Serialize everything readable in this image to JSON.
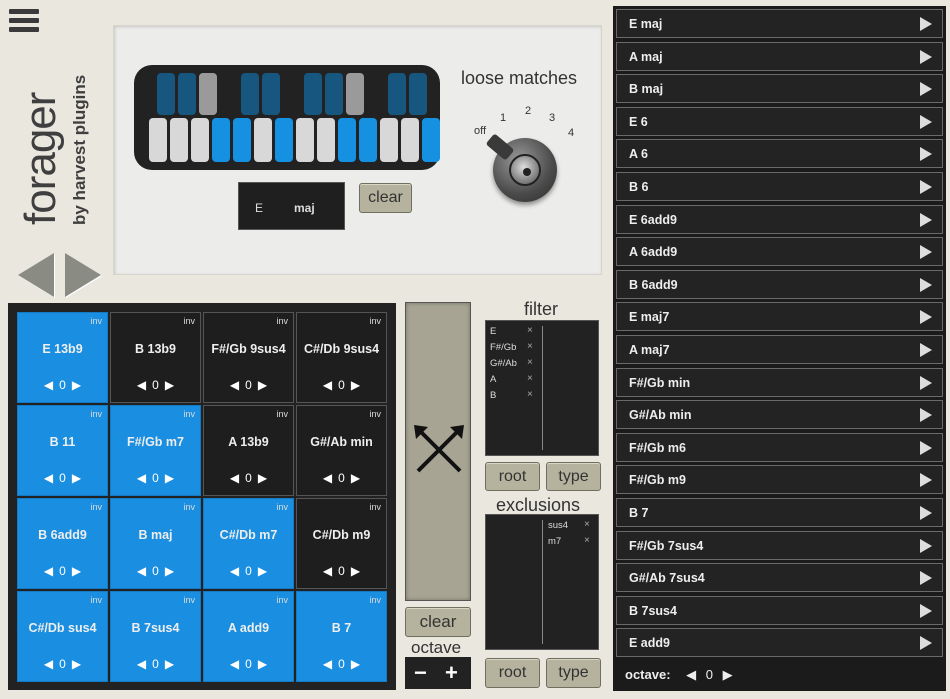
{
  "brand": {
    "name": "forager",
    "sub": "by harvest plugins"
  },
  "keyboard": {
    "white_keys_on": [
      3,
      4,
      6,
      9,
      10,
      13
    ],
    "black_keys": [
      {
        "state": "dark"
      },
      {
        "state": "dark"
      },
      {
        "state": "gray"
      },
      {
        "state": "dark"
      },
      {
        "state": "dark"
      },
      {
        "state": "dark"
      },
      {
        "state": "dark"
      },
      {
        "state": "gray"
      },
      {
        "state": "dark"
      },
      {
        "state": "dark"
      }
    ],
    "colors": {
      "active": "#1690e0",
      "inactive_white": "#d8d8d8",
      "black": "#16567f",
      "gray": "#9a9a9a"
    }
  },
  "chord_display": {
    "root": "E",
    "quality": "maj"
  },
  "top_clear_label": "clear",
  "loose_matches": {
    "label": "loose matches",
    "ticks": [
      "off",
      "1",
      "2",
      "3",
      "4"
    ],
    "value": "off"
  },
  "pads": [
    {
      "name": "E 13b9",
      "inv": "inv",
      "value": "0",
      "active": true
    },
    {
      "name": "B 13b9",
      "inv": "inv",
      "value": "0",
      "active": false
    },
    {
      "name": "F#/Gb 9sus4",
      "inv": "inv",
      "value": "0",
      "active": false
    },
    {
      "name": "C#/Db 9sus4",
      "inv": "inv",
      "value": "0",
      "active": false
    },
    {
      "name": "B 11",
      "inv": "inv",
      "value": "0",
      "active": true
    },
    {
      "name": "F#/Gb m7",
      "inv": "inv",
      "value": "0",
      "active": true
    },
    {
      "name": "A 13b9",
      "inv": "inv",
      "value": "0",
      "active": false
    },
    {
      "name": "G#/Ab min",
      "inv": "inv",
      "value": "0",
      "active": false
    },
    {
      "name": "B 6add9",
      "inv": "inv",
      "value": "0",
      "active": true
    },
    {
      "name": "B maj",
      "inv": "inv",
      "value": "0",
      "active": true
    },
    {
      "name": "C#/Db m7",
      "inv": "inv",
      "value": "0",
      "active": true
    },
    {
      "name": "C#/Db m9",
      "inv": "inv",
      "value": "0",
      "active": false
    },
    {
      "name": "C#/Db sus4",
      "inv": "inv",
      "value": "0",
      "active": true
    },
    {
      "name": "B 7sus4",
      "inv": "inv",
      "value": "0",
      "active": true
    },
    {
      "name": "A add9",
      "inv": "inv",
      "value": "0",
      "active": true
    },
    {
      "name": "B 7",
      "inv": "inv",
      "value": "0",
      "active": true
    }
  ],
  "bottom_clear_label": "clear",
  "octave": {
    "label": "octave",
    "minus": "−",
    "plus": "+"
  },
  "filter": {
    "label": "filter",
    "items": [
      "E",
      "F#/Gb",
      "G#/Ab",
      "A",
      "B"
    ],
    "remove_glyph": "×",
    "root_label": "root",
    "type_label": "type"
  },
  "exclusions": {
    "label": "exclusions",
    "items": [
      "sus4",
      "m7"
    ],
    "remove_glyph": "×",
    "root_label": "root",
    "type_label": "type"
  },
  "chord_list": {
    "items": [
      "E maj",
      "A maj",
      "B maj",
      "E 6",
      "A 6",
      "B 6",
      "E 6add9",
      "A 6add9",
      "B 6add9",
      "E maj7",
      "A maj7",
      "F#/Gb min",
      "G#/Ab min",
      "F#/Gb m6",
      "F#/Gb m9",
      "B 7",
      "F#/Gb 7sus4",
      "G#/Ab 7sus4",
      "B 7sus4",
      "E add9"
    ],
    "octave_label": "octave:",
    "octave_value": "0",
    "octave_left": "◀",
    "octave_right": "▶"
  }
}
